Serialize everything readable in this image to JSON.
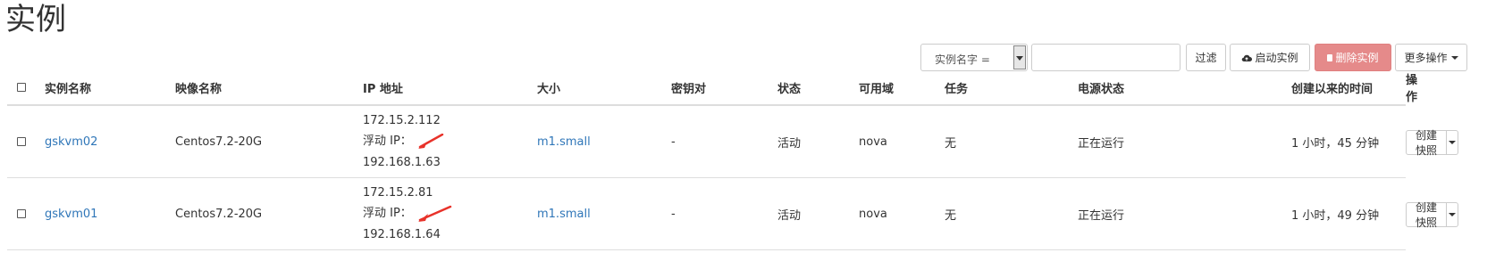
{
  "page": {
    "title": "实例"
  },
  "toolbar": {
    "filter_select_label": "实例名字 =",
    "filter_input_value": "",
    "filter_button": "过滤",
    "launch_button": "启动实例",
    "delete_button": "删除实例",
    "more_button": "更多操作"
  },
  "table": {
    "headers": [
      "实例名称",
      "映像名称",
      "IP 地址",
      "大小",
      "密钥对",
      "状态",
      "可用域",
      "任务",
      "电源状态",
      "创建以来的时间",
      "操作"
    ],
    "rows": [
      {
        "name": "gskvm02",
        "image": "Centos7.2-20G",
        "ip_fixed": "172.15.2.112",
        "ip_floating_label": "浮动 IP：",
        "ip_floating": "192.168.1.63",
        "size": "m1.small",
        "keypair": "-",
        "status": "活动",
        "zone": "nova",
        "task": "无",
        "power": "正在运行",
        "age": "1 小时，45 分钟",
        "action": "创建快照"
      },
      {
        "name": "gskvm01",
        "image": "Centos7.2-20G",
        "ip_fixed": "172.15.2.81",
        "ip_floating_label": "浮动 IP：",
        "ip_floating": "192.168.1.64",
        "size": "m1.small",
        "keypair": "-",
        "status": "活动",
        "zone": "nova",
        "task": "无",
        "power": "正在运行",
        "age": "1 小时，49 分钟",
        "action": "创建快照"
      }
    ]
  },
  "colors": {
    "link": "#2f76b8",
    "danger": "#e58a8a",
    "annotation_arrow": "#e8322a"
  },
  "icons": {
    "launch": "cloud-upload-icon",
    "delete": "trash-icon",
    "checkbox": "checkbox-icon",
    "annotation": "red-arrow-annotation-icon"
  }
}
